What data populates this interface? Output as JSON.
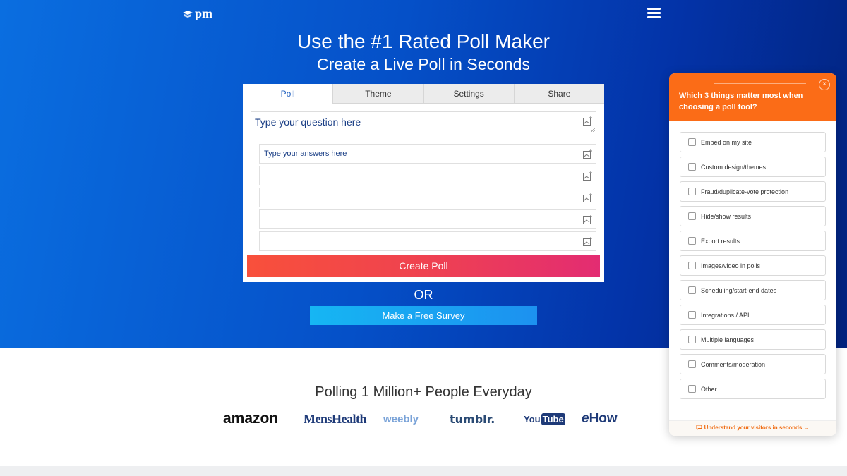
{
  "header": {
    "logo_text": "pm",
    "title": "Use the #1 Rated Poll Maker",
    "subtitle": "Create a Live Poll in Seconds"
  },
  "poll_card": {
    "tabs": [
      {
        "label": "Poll",
        "active": true
      },
      {
        "label": "Theme",
        "active": false
      },
      {
        "label": "Settings",
        "active": false
      },
      {
        "label": "Share",
        "active": false
      }
    ],
    "question_placeholder": "Type your question here",
    "answers": [
      {
        "placeholder": "Type your answers here"
      },
      {
        "placeholder": ""
      },
      {
        "placeholder": ""
      },
      {
        "placeholder": ""
      },
      {
        "placeholder": ""
      }
    ],
    "create_button": "Create Poll"
  },
  "or_text": "OR",
  "survey_button": "Make a Free Survey",
  "social_proof": {
    "heading": "Polling 1 Million+ People Everyday",
    "brands": [
      "amazon",
      "MensHealth",
      "weebly",
      "tumblr.",
      "You",
      "Tube",
      "e",
      "How"
    ]
  },
  "widget": {
    "question": "Which 3 things matter most when choosing a poll tool?",
    "close_symbol": "×",
    "options": [
      "Embed on my site",
      "Custom design/themes",
      "Fraud/duplicate-vote protection",
      "Hide/show results",
      "Export results",
      "Images/video in polls",
      "Scheduling/start-end dates",
      "Integrations / API",
      "Multiple languages",
      "Comments/moderation",
      "Other"
    ],
    "footer_link": "Understand your visitors in seconds"
  },
  "colors": {
    "hero_gradient_start": "#0a6ee0",
    "hero_gradient_end": "#02237e",
    "create_button": "#ef4250",
    "survey_button": "#1c91f0",
    "widget_accent": "#fb6c17"
  }
}
